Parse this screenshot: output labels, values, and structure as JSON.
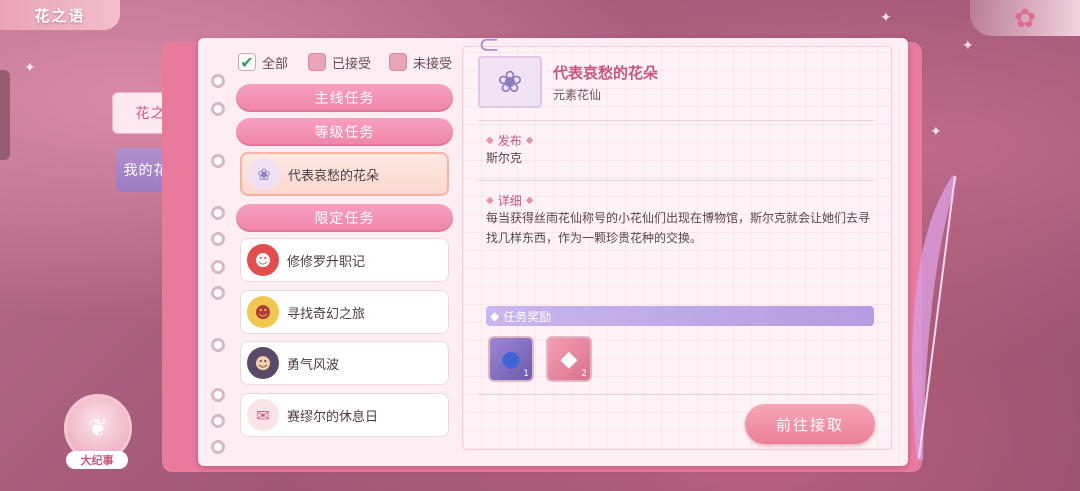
{
  "header": {
    "title": "花之语",
    "close_icon": "flower-close-icon"
  },
  "side_tabs": [
    {
      "label": "花之语",
      "active": false
    },
    {
      "label": "我的花语录",
      "active": true
    }
  ],
  "filters": [
    {
      "label": "全部",
      "checked": true
    },
    {
      "label": "已接受",
      "checked": false
    },
    {
      "label": "未接受",
      "checked": false
    }
  ],
  "categories": {
    "main": "主线任务",
    "level": "等级任务",
    "limited": "限定任务"
  },
  "quests": [
    {
      "title": "代表哀愁的花朵",
      "icon": "hydrangea-icon",
      "selected": true
    },
    {
      "title": "修修罗升职记",
      "icon": "red-hair-character-icon",
      "selected": false
    },
    {
      "title": "寻找奇幻之旅",
      "icon": "blonde-character-icon",
      "selected": false
    },
    {
      "title": "勇气风波",
      "icon": "capped-character-icon",
      "selected": false
    },
    {
      "title": "赛缪尔的休息日",
      "icon": "letter-icon",
      "selected": false
    }
  ],
  "detail": {
    "title": "代表哀愁的花朵",
    "subtitle": "元素花仙",
    "publish_label": "发布",
    "publisher": "斯尔克",
    "detail_label": "详细",
    "description": "每当获得丝雨花仙称号的小花仙们出现在博物馆，斯尔克就会让她们去寻找几样东西，作为一颗珍贵花种的交换。",
    "reward_label": "任务奖励",
    "rewards": [
      {
        "icon": "potion-bottle-icon",
        "count": "1"
      },
      {
        "icon": "pink-gem-icon",
        "count": "2"
      }
    ],
    "action_label": "前往接取"
  },
  "chronicle": {
    "label": "大纪事",
    "icon": "book-unicorn-icon"
  },
  "colors": {
    "accent": "#ec7f97",
    "title": "#c9557d",
    "tab_active": "#9c7bc2",
    "reward_bar": "#b49ce0"
  }
}
